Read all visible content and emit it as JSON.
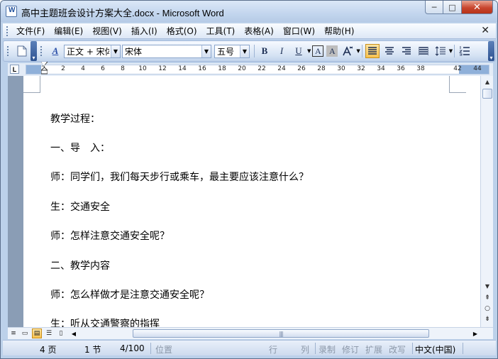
{
  "window": {
    "title": "高中主题班会设计方案大全.docx - Microsoft Word",
    "minimize_glyph": "─",
    "maximize_glyph": "□",
    "close_glyph": "✕"
  },
  "menubar": {
    "items": [
      "文件(F)",
      "编辑(E)",
      "视图(V)",
      "插入(I)",
      "格式(O)",
      "工具(T)",
      "表格(A)",
      "窗口(W)",
      "帮助(H)"
    ],
    "close_glyph": "✕"
  },
  "toolbar": {
    "style_value": "正文 + 宋体",
    "font_value": "宋体",
    "size_value": "五号",
    "bold": "B",
    "italic": "I",
    "underline": "U",
    "char_border": "A",
    "char_shading": "A",
    "styles_icon_glyph": "A"
  },
  "ruler": {
    "tab_selector": "L",
    "numbers": [
      "2",
      "2",
      "4",
      "6",
      "8",
      "10",
      "12",
      "14",
      "16",
      "18",
      "20",
      "22",
      "24",
      "26",
      "28",
      "30",
      "32",
      "34",
      "36",
      "38",
      "42",
      "44"
    ]
  },
  "document": {
    "paragraphs": [
      "教学过程：",
      "一、导　入：",
      "师：同学们，我们每天步行或乘车，最主要应该注意什么？",
      "生：交通安全",
      "师：怎样注意交通安全呢？",
      "二、教学内容",
      "师：怎么样做才是注意交通安全呢？",
      "生：听从交通警察的指挥"
    ]
  },
  "statusbar": {
    "page": "4 页",
    "section": "1 节",
    "page_of": "4/100",
    "position": "位置",
    "line": "行",
    "column": "列",
    "record": "录制",
    "revise": "修订",
    "extend": "扩展",
    "overtype": "改写",
    "language": "中文(中国)"
  },
  "colors": {
    "title_gradient_top": "#dbe8f7",
    "close_button": "#c8462f",
    "active_button": "#f8c24f",
    "doc_background": "#8a9db5"
  }
}
